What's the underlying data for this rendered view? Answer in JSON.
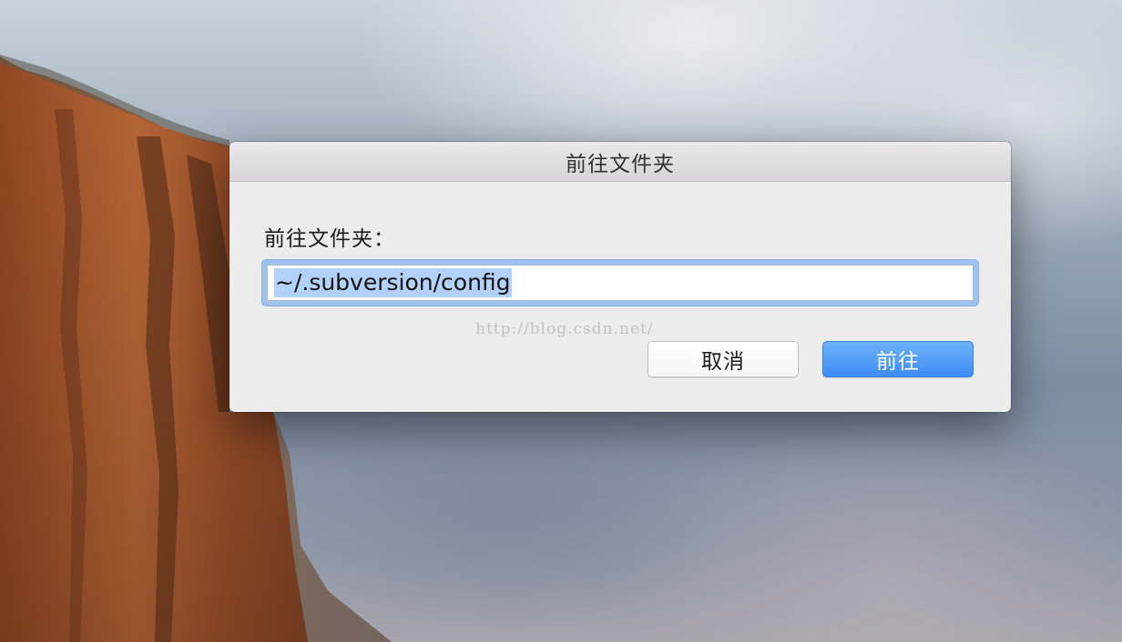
{
  "dialog": {
    "title": "前往文件夹",
    "prompt_label": "前往文件夹：",
    "path_value": "~/.subversion/config",
    "cancel_label": "取消",
    "go_label": "前往"
  },
  "watermark": {
    "text": "http://blog.csdn.net/"
  },
  "colors": {
    "primary_button": "#4a96f8",
    "focus_ring": "#9fc2ee",
    "selection": "#b2d2fb",
    "dialog_bg": "#ececec"
  }
}
